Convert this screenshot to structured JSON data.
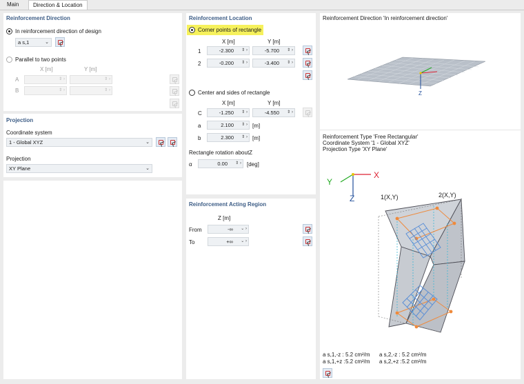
{
  "tabs": [
    "Main",
    "Direction & Location"
  ],
  "reinforcement_direction": {
    "title": "Reinforcement Direction",
    "option_design": "In reinforcement direction of design",
    "direction_value": "a s,1",
    "option_parallel": "Parallel to two points",
    "col_x": "X [m]",
    "col_y": "Y [m]",
    "row_a": "A",
    "row_b": "B"
  },
  "projection": {
    "title": "Projection",
    "coord_label": "Coordinate system",
    "coord_value": "1 - Global XYZ",
    "proj_label": "Projection",
    "proj_value": "XY Plane"
  },
  "location": {
    "title": "Reinforcement Location",
    "option_corner": "Corner points of rectangle",
    "col_x": "X [m]",
    "col_y": "Y [m]",
    "rows": [
      {
        "label": "1",
        "x": "-2.300",
        "y": "-5.700"
      },
      {
        "label": "2",
        "x": "-0.200",
        "y": "-3.400"
      }
    ],
    "option_center": "Center and sides of rectangle",
    "c_label": "C",
    "c_x": "-1.250",
    "c_y": "-4.550",
    "a_label": "a",
    "a_value": "2.100",
    "a_unit": "[m]",
    "b_label": "b",
    "b_value": "2.300",
    "b_unit": "[m]",
    "rot_label": "Rectangle rotation aboutZ",
    "alpha_label": "α",
    "alpha_value": "0.00",
    "alpha_unit": "[deg]"
  },
  "acting": {
    "title": "Reinforcement Acting Region",
    "col_z": "Z [m]",
    "from_label": "From",
    "from_value": "-∞",
    "to_label": "To",
    "to_value": "+∞"
  },
  "preview": {
    "top_title": "Reinforcement Direction 'In reinforcement direction'",
    "info_line1": "Reinforcement Type 'Free Rectangular'",
    "info_line2": "Coordinate System '1 - Global XYZ'",
    "info_line3": "Projection Type 'XY Plane'",
    "axis_x": "X",
    "axis_y": "Y",
    "axis_z": "Z",
    "pt1": "1(X,Y)",
    "pt2": "2(X,Y)",
    "legend": [
      {
        "name": "a s,1,-z :",
        "value": "5.2 cm²/m"
      },
      {
        "name": "a s,2,-z :",
        "value": "5.2 cm²/m"
      },
      {
        "name": "a s,1,+z :",
        "value": "5.2 cm²/m"
      },
      {
        "name": "a s,2,+z :",
        "value": "5.2 cm²/m"
      }
    ]
  },
  "colors": {
    "title": "#3d5d86",
    "highlight": "#f6f15c",
    "mesh": "#5b8fd6",
    "handles": "#ef8a3c"
  }
}
